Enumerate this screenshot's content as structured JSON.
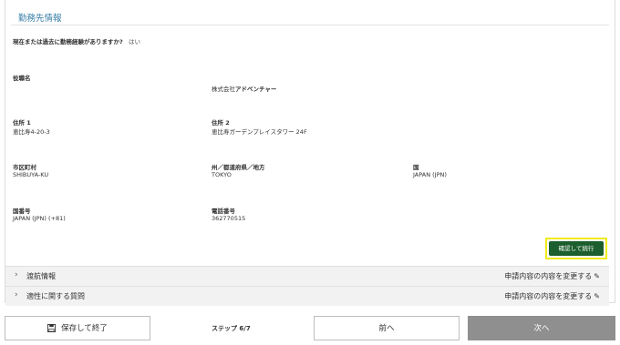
{
  "section": {
    "title": "勤務先情報"
  },
  "experience": {
    "question": "現在または過去に勤務経験がありますか?",
    "answer": "はい"
  },
  "fields": {
    "job_title": {
      "label": "役職名",
      "company_prefix": "株式会社",
      "company_name": "アドベンチャー"
    },
    "address1": {
      "label": "住所 1",
      "value": "恵比寿4-20-3"
    },
    "address2": {
      "label": "住所 2",
      "value": "恵比寿ガーデンプレイスタワー 24F"
    },
    "city": {
      "label": "市区町村",
      "value": "SHIBUYA-KU"
    },
    "state": {
      "label": "州／都道府県／地方",
      "value": "TOKYO"
    },
    "country": {
      "label": "国",
      "value": "JAPAN (JPN)"
    },
    "country_code": {
      "label": "国番号",
      "value": "JAPAN (JPN) (+81)"
    },
    "phone": {
      "label": "電話番号",
      "value": "362770515"
    }
  },
  "confirm_button": "確認して続行",
  "accordion": [
    {
      "title": "渡航情報",
      "edit": "申請内容の内容を変更する"
    },
    {
      "title": "適性に関する質問",
      "edit": "申請内容の内容を変更する"
    }
  ],
  "footer": {
    "save_label": "保存して終了",
    "step_label": "ステップ 6/7",
    "prev_label": "前へ",
    "next_label": "次へ"
  },
  "colors": {
    "accent_blue": "#3a7fa8",
    "confirm_green": "#1c5e2d",
    "highlight_yellow": "#f2ea1d",
    "next_gray": "#8f8f8f"
  },
  "icons": {
    "accordion": "chevron-right-icon",
    "edit": "pencil-icon",
    "save": "save-disk-icon"
  }
}
